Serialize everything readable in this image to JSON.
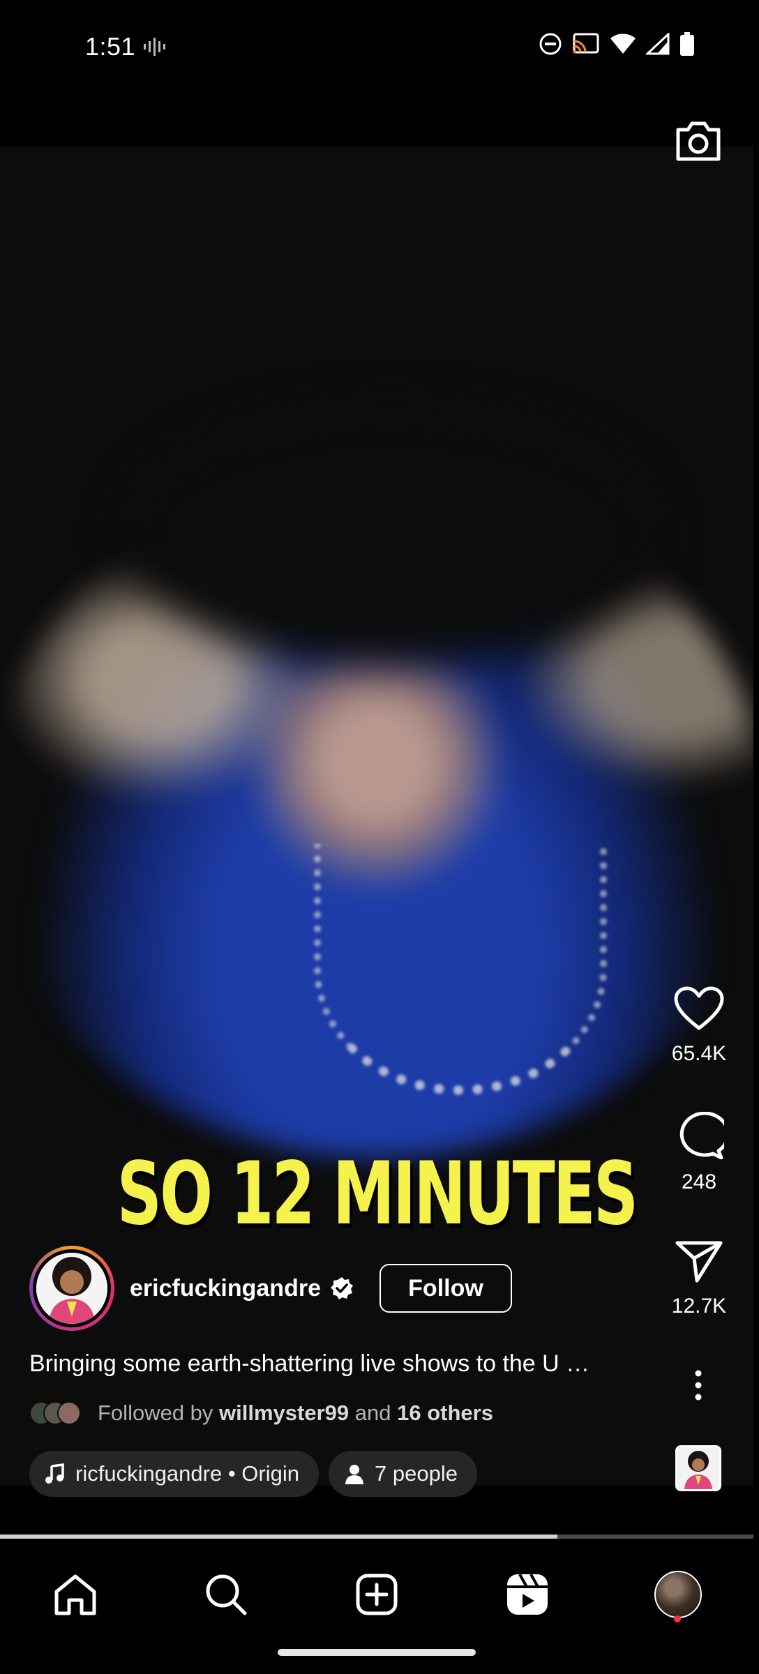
{
  "status_bar": {
    "time": "1:51",
    "icons": [
      "voice-activity-icon",
      "do-not-disturb-icon",
      "cast-icon",
      "wifi-icon",
      "signal-icon",
      "battery-icon"
    ]
  },
  "video": {
    "caption": "SO 12 MINUTES",
    "caption_color": "#f5f24e",
    "progress_percent": 74
  },
  "actions": {
    "likes": "65.4K",
    "comments": "248",
    "shares": "12.7K"
  },
  "creator": {
    "username": "ericfuckingandre",
    "verified": true,
    "follow_label": "Follow"
  },
  "post": {
    "description": "Bringing some earth-shattering live shows to the U …",
    "followed_prefix": "Followed by",
    "followed_user": "willmyster99",
    "followed_and": "and",
    "followed_others": "16 others"
  },
  "chips": {
    "audio": "ricfuckingandre • Origin",
    "people": "7 people"
  },
  "nav": {
    "items": [
      "home-icon",
      "search-icon",
      "create-icon",
      "reels-icon",
      "profile-avatar"
    ],
    "notification_color": "#ff3040"
  }
}
